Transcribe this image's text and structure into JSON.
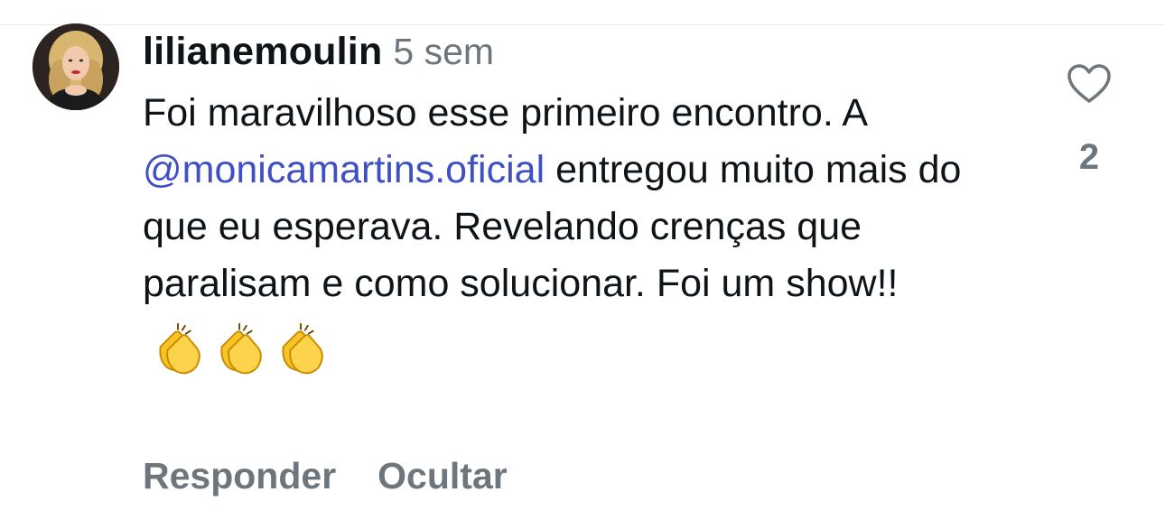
{
  "comment": {
    "username": "lilianemoulin",
    "time": "5 sem",
    "text_before_mention": "Foi maravilhoso esse primeiro encontro. A ",
    "mention": "@monicamartins.oficial",
    "text_after_mention": " entregou muito mais do que eu esperava. Revelando crenças que paralisam e como solucionar. Foi um show!!",
    "emojis": [
      "clapping-hands",
      "clapping-hands",
      "clapping-hands"
    ]
  },
  "like": {
    "icon": "heart-outline-icon",
    "count": "2"
  },
  "actions": {
    "reply_label": "Responder",
    "hide_label": "Ocultar"
  },
  "colors": {
    "text": "#0f1419",
    "muted": "#6e767d",
    "mention": "#3f4fc4",
    "emoji_yellow": "#f7c325"
  }
}
